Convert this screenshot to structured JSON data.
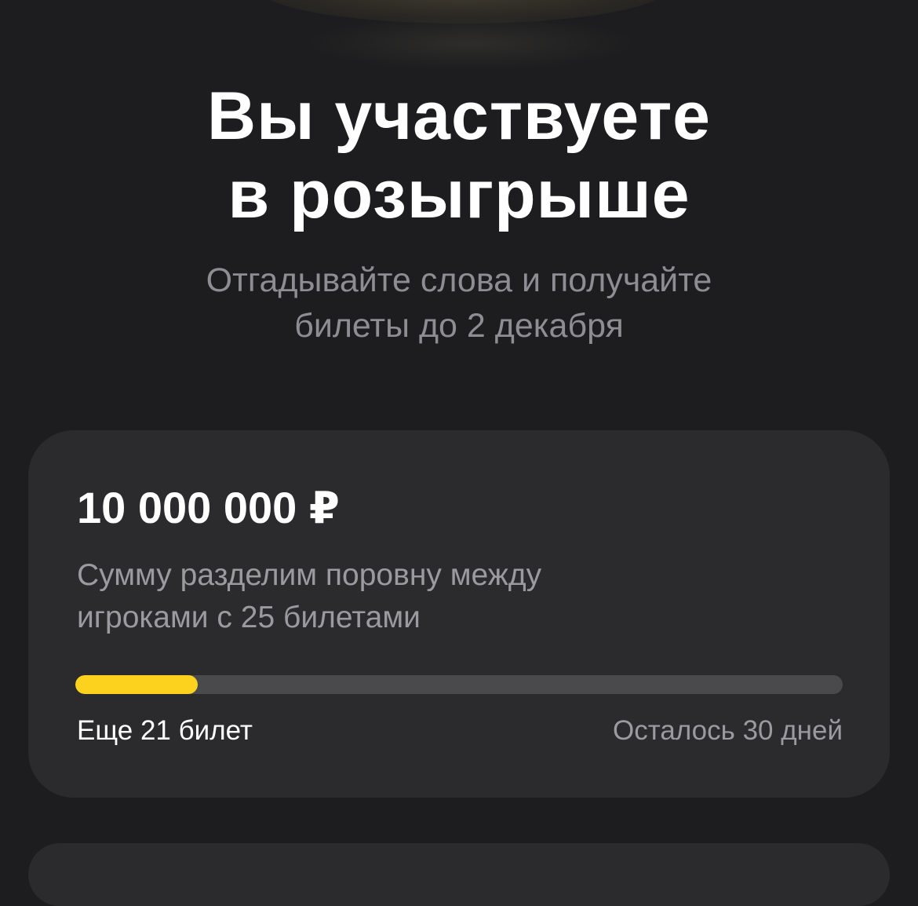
{
  "header": {
    "title_line1": "Вы участвуете",
    "title_line2": "в розыгрыше",
    "subtitle_line1": "Отгадывайте слова и получайте",
    "subtitle_line2": "билеты до 2 декабря"
  },
  "prize_card": {
    "amount": "10 000 000 ₽",
    "description_line1": "Сумму разделим поровну между",
    "description_line2": "игроками с 25 билетами",
    "progress_fraction": 0.16,
    "tickets_remaining": "Еще 21 билет",
    "days_left": "Осталось 30 дней"
  },
  "colors": {
    "background": "#1d1d1f",
    "card": "#2b2b2d",
    "accent": "#fcd21f",
    "track": "#4a4a4d"
  }
}
